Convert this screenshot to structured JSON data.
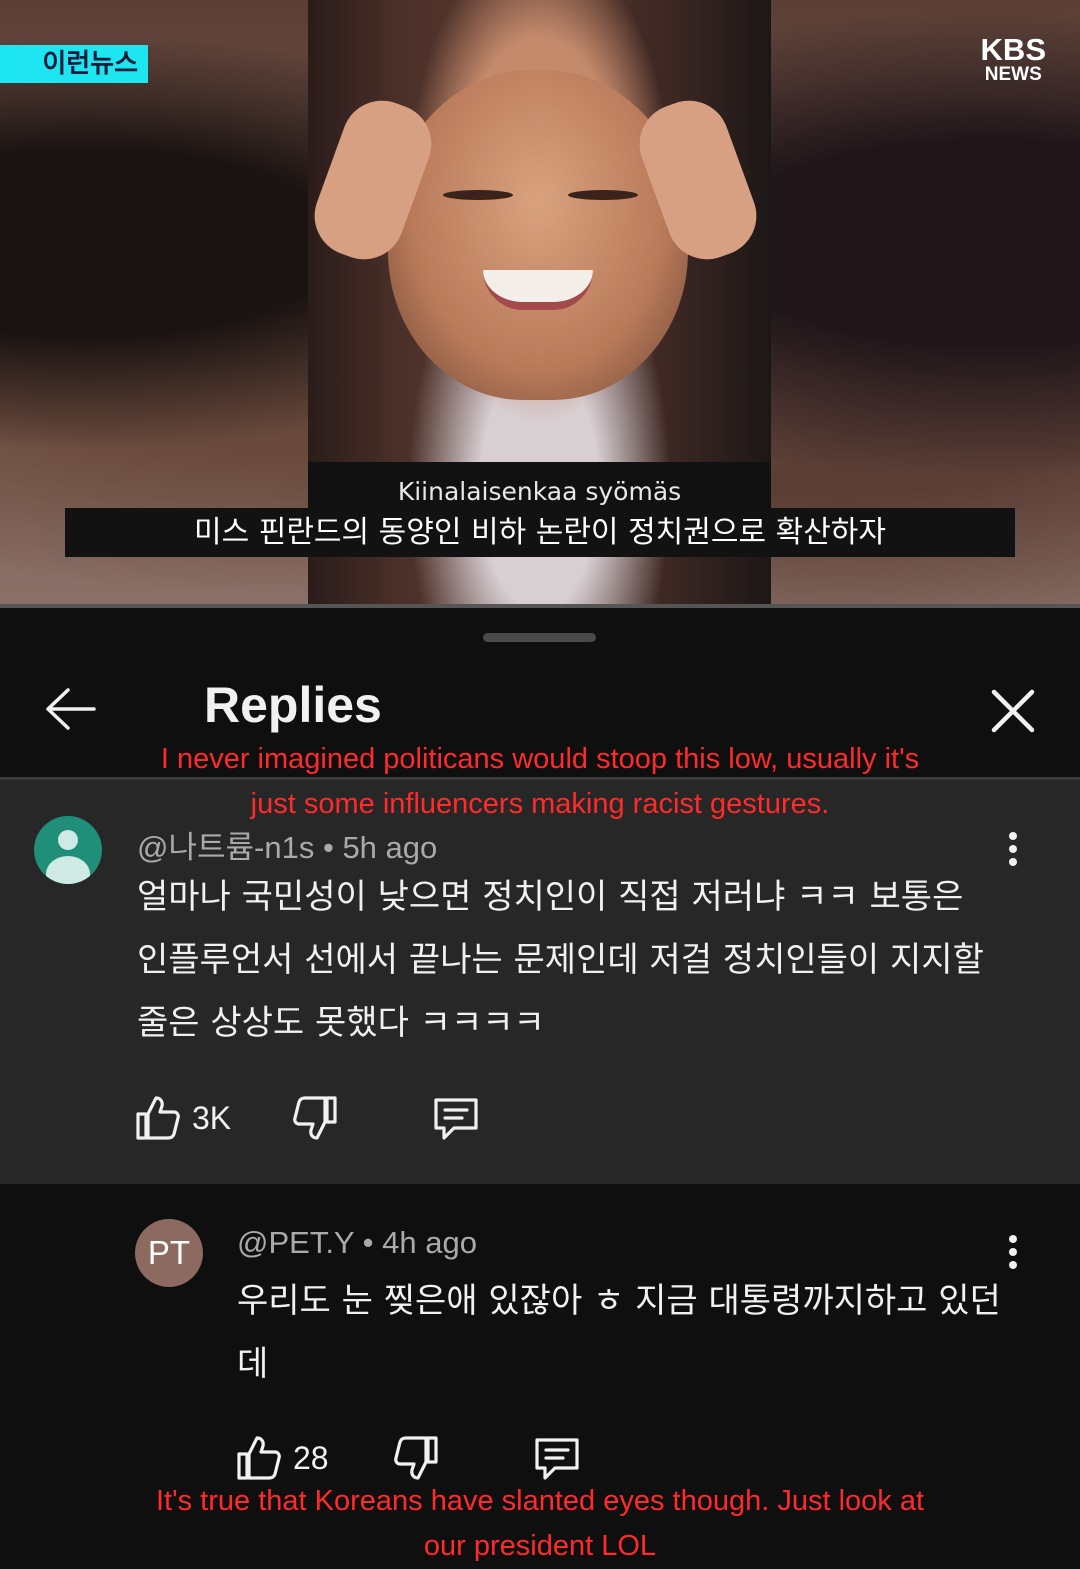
{
  "video": {
    "channel_tag": "이런뉴스",
    "logo_top": "KBS",
    "logo_bottom": "NEWS",
    "subtitle_original": "Kiinalaisenkaa syömäs",
    "subtitle_korean": "미스 핀란드의 동양인 비하 논란이 정치권으로 확산하자"
  },
  "panel": {
    "title": "Replies"
  },
  "overlay_translations": {
    "first_line1": "I never imagined politicans would stoop this low, usually it's",
    "first_line2": "just some influencers making racist gestures.",
    "second_line1": "It's true that Koreans have slanted eyes though. Just look at",
    "second_line2": "our president LOL"
  },
  "comments": [
    {
      "author": "@나트륨-n1s",
      "time": "5h ago",
      "text": "얼마나 국민성이 낮으면 정치인이 직접 저러냐 ㅋㅋ 보통은 인플루언서 선에서 끝나는 문제인데 저걸 정치인들이 지지할줄은 상상도 못했다 ㅋㅋㅋㅋ",
      "likes": "3K"
    },
    {
      "author": "@PET.Y",
      "avatar_initials": "PT",
      "time": "4h ago",
      "text": "우리도 눈 찢은애 있잖아 ㅎ 지금 대통령까지하고 있던데",
      "likes": "28"
    }
  ],
  "icons": [
    "back-arrow-icon",
    "close-icon",
    "avatar-person-icon",
    "more-vert-icon",
    "thumbs-up-icon",
    "thumbs-down-icon",
    "reply-comment-icon"
  ],
  "colors": {
    "overlay_text": "#ff2a2a",
    "tag_bg": "#1ee6f0",
    "highlight_comment_bg": "#272727"
  }
}
